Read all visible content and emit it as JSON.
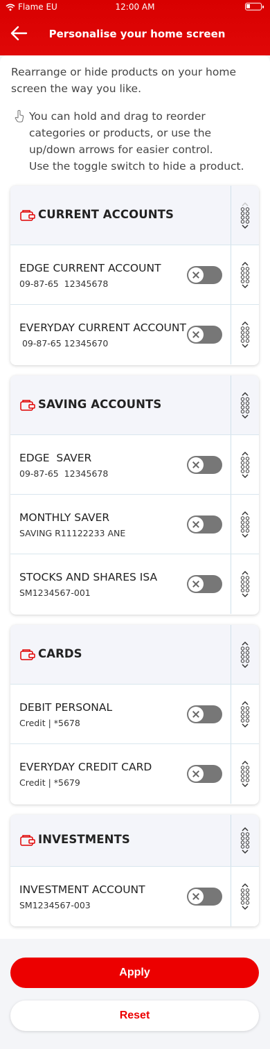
{
  "status_bar": {
    "carrier": "Flame EU",
    "time": "12:00 AM"
  },
  "header": {
    "title": "Personalise your home screen",
    "back_icon": "arrow-left-icon"
  },
  "intro": "Rearrange or hide products on your home screen the way you like.",
  "hint": {
    "icon": "hand-touch-icon",
    "line1": "You can hold and drag to reorder categories or products, or use the up/down arrows for easier control.",
    "line2": "Use the toggle switch to hide a product."
  },
  "groups": [
    {
      "label": "CURRENT ACCOUNTS",
      "items": [
        {
          "name": "EDGE CURRENT ACCOUNT",
          "sub": "09-87-65  12345678",
          "visible": false
        },
        {
          "name": "EVERYDAY CURRENT ACCOUNT",
          "sub": " 09-87-65 12345670",
          "visible": false
        }
      ]
    },
    {
      "label": "SAVING ACCOUNTS",
      "items": [
        {
          "name": "EDGE  SAVER",
          "sub": "09-87-65  12345678",
          "visible": false
        },
        {
          "name": "MONTHLY SAVER",
          "sub": "SAVING R11122233 ANE",
          "visible": false
        },
        {
          "name": "STOCKS AND SHARES ISA",
          "sub": "SM1234567-001",
          "visible": false
        }
      ]
    },
    {
      "label": "CARDS",
      "items": [
        {
          "name": "DEBIT PERSONAL",
          "sub": "Credit | *5678",
          "visible": false
        },
        {
          "name": "EVERYDAY CREDIT CARD",
          "sub": "Credit | *5679",
          "visible": false
        }
      ]
    },
    {
      "label": "INVESTMENTS",
      "items": [
        {
          "name": "INVESTMENT ACCOUNT",
          "sub": "SM1234567-003",
          "visible": false
        }
      ]
    }
  ],
  "buttons": {
    "apply": "Apply",
    "reset": "Reset"
  },
  "colors": {
    "brand": "#ec0000",
    "toggle_off": "#777777"
  }
}
